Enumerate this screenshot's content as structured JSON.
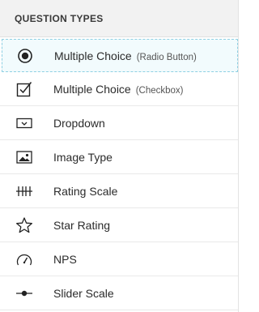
{
  "panel": {
    "title": "QUESTION TYPES"
  },
  "items": [
    {
      "label": "Multiple Choice",
      "sub": "(Radio Button)",
      "icon": "radio-button-icon",
      "selected": true
    },
    {
      "label": "Multiple Choice",
      "sub": "(Checkbox)",
      "icon": "checkbox-icon",
      "selected": false
    },
    {
      "label": "Dropdown",
      "sub": "",
      "icon": "dropdown-icon",
      "selected": false
    },
    {
      "label": "Image Type",
      "sub": "",
      "icon": "image-icon",
      "selected": false
    },
    {
      "label": "Rating Scale",
      "sub": "",
      "icon": "rating-scale-icon",
      "selected": false
    },
    {
      "label": "Star Rating",
      "sub": "",
      "icon": "star-icon",
      "selected": false
    },
    {
      "label": "NPS",
      "sub": "",
      "icon": "gauge-icon",
      "selected": false
    },
    {
      "label": "Slider Scale",
      "sub": "",
      "icon": "slider-icon",
      "selected": false
    }
  ],
  "colors": {
    "selected_border": "#8fd0e3",
    "selected_bg": "#f2fbfd",
    "header_bg": "#f2f2f2"
  }
}
